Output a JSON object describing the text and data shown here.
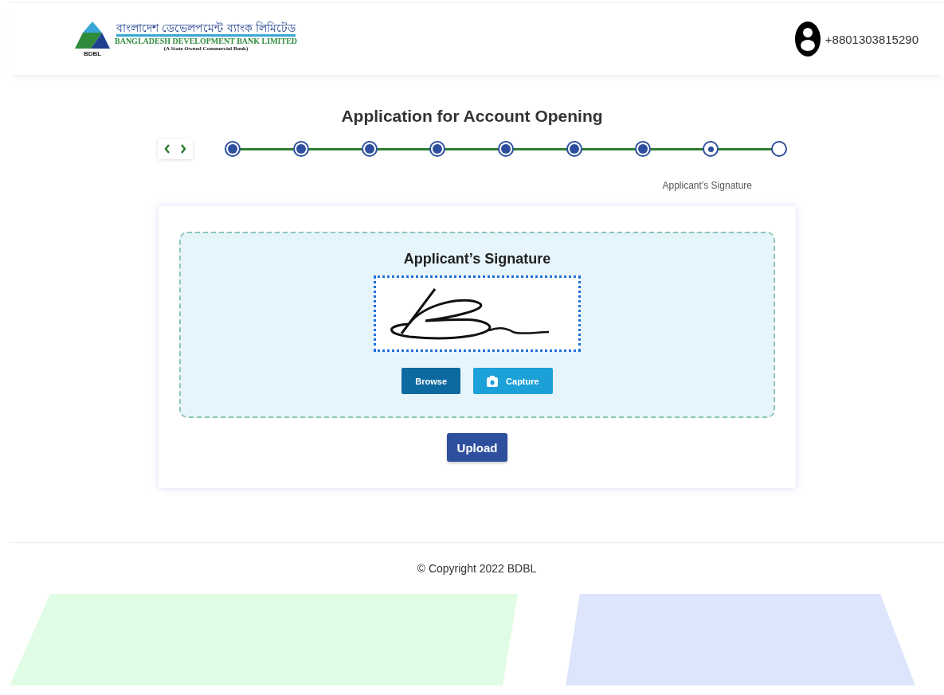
{
  "header": {
    "logo": {
      "bengali_name": "বাংলাদেশ ডেভেলপমেন্ট ব্যাংক লিমিটেড",
      "english_name": "BANGLADESH DEVELOPMENT BANK LIMITED",
      "tagline": "(A State Owned Commercial Bank)",
      "short_name": "BDBL"
    },
    "user_phone": "+8801303815290"
  },
  "title": "Application for Account Opening",
  "stepper": {
    "steps": [
      {
        "completed": true,
        "selected": false
      },
      {
        "completed": true,
        "selected": false
      },
      {
        "completed": true,
        "selected": false
      },
      {
        "completed": true,
        "selected": false
      },
      {
        "completed": true,
        "selected": false
      },
      {
        "completed": true,
        "selected": false
      },
      {
        "completed": true,
        "selected": false
      },
      {
        "completed": false,
        "selected": true
      },
      {
        "completed": false,
        "selected": false
      }
    ],
    "current_label": "Applicant’s Signature"
  },
  "card": {
    "heading": "Applicant’s Signature",
    "buttons": [
      {
        "label": "Browse",
        "kind": "browse"
      },
      {
        "label": "Capture",
        "kind": "capture"
      }
    ],
    "submit": "Upload"
  },
  "footer": {
    "copyright": "© Copyright 2022 BDBL"
  }
}
